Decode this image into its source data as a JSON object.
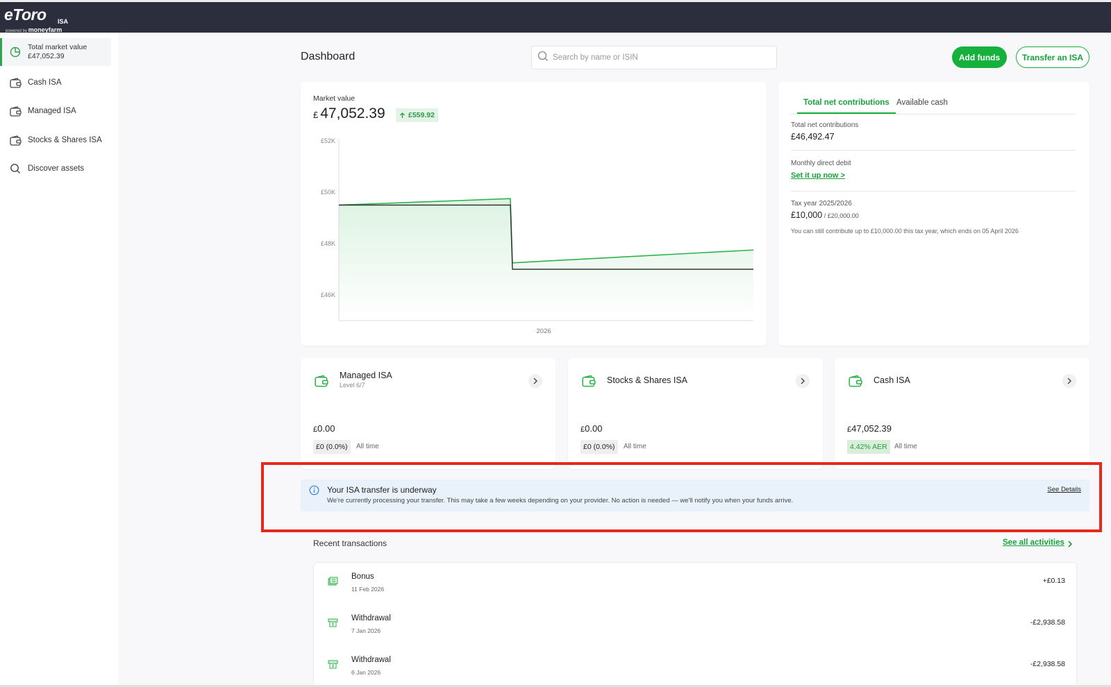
{
  "app": {
    "logo_main": "eToro",
    "logo_suffix": "ISA",
    "logo_powered": "powered by",
    "logo_partner": "moneyfarm"
  },
  "sidebar": {
    "active": {
      "label": "Total market value",
      "value": "£47,052.39",
      "icon": "pie-chart-icon"
    },
    "items": [
      {
        "label": "Cash ISA",
        "icon": "wallet-icon"
      },
      {
        "label": "Managed ISA",
        "icon": "wallet-icon"
      },
      {
        "label": "Stocks & Shares ISA",
        "icon": "wallet-icon"
      },
      {
        "label": "Discover assets",
        "icon": "search-icon"
      }
    ]
  },
  "header": {
    "title": "Dashboard",
    "search_placeholder": "Search by name or ISIN",
    "add_funds": "Add funds",
    "transfer_isa": "Transfer an ISA"
  },
  "market": {
    "label": "Market value",
    "currency": "£",
    "value": "47,052.39",
    "change": "£559.92"
  },
  "chart_data": {
    "type": "line",
    "x_label": "2026",
    "y_ticks": [
      "£52K",
      "£50K",
      "£48K",
      "£46K"
    ],
    "ylim": [
      45000,
      52000
    ],
    "series": [
      {
        "color": "#2bb34a",
        "values": [
          49500,
          49750,
          47250,
          47750
        ]
      },
      {
        "color": "#333333",
        "values": [
          49500,
          49500,
          47000,
          47000
        ]
      }
    ]
  },
  "contributions": {
    "tab_active": "Total net contributions",
    "tab_inactive": "Available cash",
    "total_label": "Total net contributions",
    "total_value": "£46,492.47",
    "debit_label": "Monthly direct debit",
    "debit_link": "Set it up now >",
    "tax_label": "Tax year 2025/2026",
    "tax_value": "£10,000",
    "tax_limit": " / £20,000.00",
    "tax_note": "You can still contribute up to £10,000.00 this tax year, which ends on 05 April 2026"
  },
  "accounts": [
    {
      "name": "Managed ISA",
      "sub": "Level 6/7",
      "currency": "£",
      "value": "0.00",
      "badge": "£0 (0.0%)",
      "period": "All time"
    },
    {
      "name": "Stocks & Shares ISA",
      "sub": "",
      "currency": "£",
      "value": "0.00",
      "badge": "£0 (0.0%)",
      "period": "All time"
    },
    {
      "name": "Cash ISA",
      "sub": "",
      "currency": "£",
      "value": "47,052.39",
      "badge": "4.42% AER",
      "period": "All time"
    }
  ],
  "banner": {
    "title": "Your ISA transfer is underway",
    "text": "We're currently processing your transfer. This may take a few weeks depending on your provider. No action is needed — we'll notify you when your funds arrive.",
    "link": "See Details"
  },
  "transactions": {
    "title": "Recent transactions",
    "see_all": "See all activities",
    "items": [
      {
        "name": "Bonus",
        "date": "11 Feb 2026",
        "amount": "+£0.13"
      },
      {
        "name": "Withdrawal",
        "date": "7 Jan 2026",
        "amount": "-£2,938.58"
      },
      {
        "name": "Withdrawal",
        "date": "6 Jan 2026",
        "amount": "-£2,938.58"
      }
    ]
  }
}
